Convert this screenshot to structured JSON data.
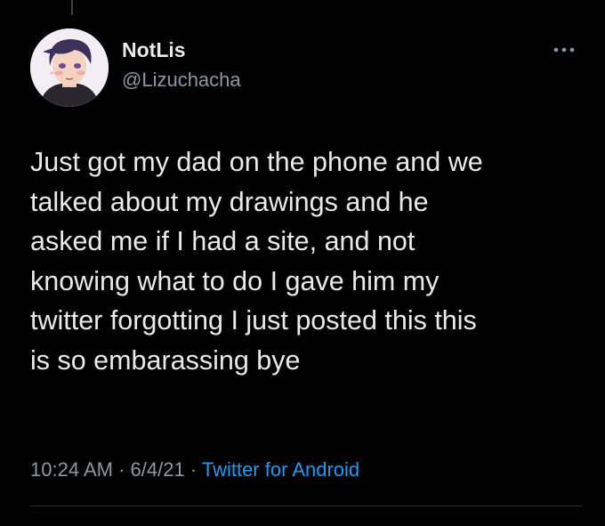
{
  "tweet": {
    "author": {
      "display_name": "NotLis",
      "handle": "@Lizuchacha",
      "avatar_icon": "anime-avatar-icon"
    },
    "more_icon": "more-horizontal-icon",
    "text_lines": [
      "Just got my dad on the phone and we",
      "talked about my drawings and he",
      "asked me if I had a site, and not",
      "knowing what to do I gave him my",
      "twitter forgotting I just posted this this",
      "is so embarassing bye"
    ],
    "meta": {
      "time": "10:24 AM",
      "separator": " · ",
      "date": "6/4/21",
      "source": "Twitter for Android"
    }
  },
  "colors": {
    "background": "#000000",
    "text_primary": "#e7e9ea",
    "text_secondary": "#8b98a5",
    "link": "#1d9bf0",
    "divider": "#2f3336"
  }
}
